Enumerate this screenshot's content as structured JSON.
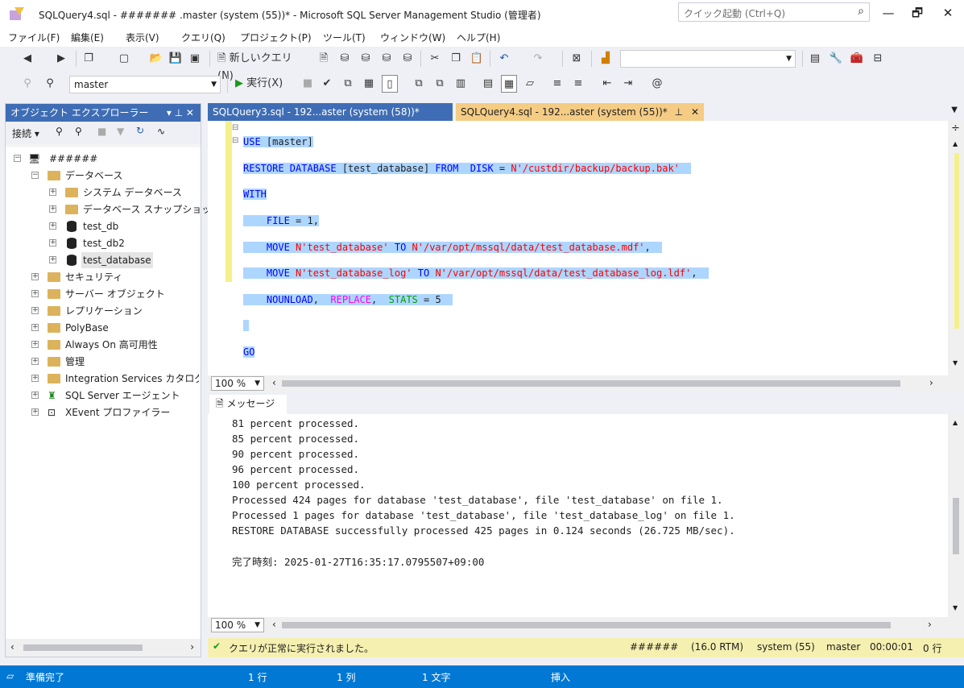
{
  "window": {
    "title": "SQLQuery4.sql - ####### .master (system (55))* - Microsoft SQL Server Management Studio (管理者)",
    "quick_launch_placeholder": "クイック起動 (Ctrl+Q)",
    "minimize": "—",
    "maximize": "🗗",
    "close": "✕"
  },
  "menu": [
    "ファイル(F)",
    "編集(E)",
    "表示(V)",
    "クエリ(Q)",
    "プロジェクト(P)",
    "ツール(T)",
    "ウィンドウ(W)",
    "ヘルプ(H)"
  ],
  "toolbar": {
    "new_query": "新しいクエリ(N)",
    "database": "master",
    "execute": "実行(X)"
  },
  "object_explorer": {
    "title": "オブジェクト エクスプローラー",
    "connect": "接続",
    "server": "######",
    "nodes": [
      {
        "label": "データベース",
        "expand": "−"
      },
      {
        "label": "システム データベース",
        "expand": "+"
      },
      {
        "label": "データベース スナップショット",
        "expand": "+"
      },
      {
        "label": "test_db",
        "expand": "+"
      },
      {
        "label": "test_db2",
        "expand": "+"
      },
      {
        "label": "test_database",
        "expand": "+"
      },
      {
        "label": "セキュリティ",
        "expand": "+"
      },
      {
        "label": "サーバー オブジェクト",
        "expand": "+"
      },
      {
        "label": "レプリケーション",
        "expand": "+"
      },
      {
        "label": "PolyBase",
        "expand": "+"
      },
      {
        "label": "Always On 高可用性",
        "expand": "+"
      },
      {
        "label": "管理",
        "expand": "+"
      },
      {
        "label": "Integration Services カタログ",
        "expand": "+"
      },
      {
        "label": "SQL Server エージェント",
        "expand": "+"
      },
      {
        "label": "XEvent プロファイラー",
        "expand": "+"
      }
    ]
  },
  "tabs": [
    {
      "label": "SQLQuery3.sql - 192...aster (system (58))*"
    },
    {
      "label": "SQLQuery4.sql - 192...aster (system (55))*"
    }
  ],
  "editor": {
    "zoom": "100 %",
    "lines": {
      "l1a": "USE",
      "l1b": " [master]",
      "l2a": "RESTORE DATABASE",
      "l2b": " [test_database] ",
      "l2c": "FROM",
      "l2d": "  DISK",
      "l2e": " = ",
      "l2f": "N'/custdir/backup/backup.bak'",
      "l3": "WITH",
      "l4a": "    FILE",
      "l4b": " = 1,",
      "l5a": "    MOVE ",
      "l5b": "N'test_database'",
      "l5c": " TO ",
      "l5d": "N'/var/opt/mssql/data/test_database.mdf'",
      "l5e": ",",
      "l6a": "    MOVE ",
      "l6b": "N'test_database_log'",
      "l6c": " TO ",
      "l6d": "N'/var/opt/mssql/data/test_database_log.ldf'",
      "l6e": ",",
      "l7a": "    NOUNLOAD",
      "l7b": ",  ",
      "l7c": "REPLACE",
      "l7d": ",  ",
      "l7e": "STATS",
      "l7f": " = 5",
      "l9": "GO"
    }
  },
  "messages": {
    "tab": "メッセージ",
    "zoom": "100 %",
    "lines": [
      "81 percent processed.",
      "85 percent processed.",
      "90 percent processed.",
      "96 percent processed.",
      "100 percent processed.",
      "Processed 424 pages for database 'test_database', file 'test_database' on file 1.",
      "Processed 1 pages for database 'test_database', file 'test_database_log' on file 1.",
      "RESTORE DATABASE successfully processed 425 pages in 0.124 seconds (26.725 MB/sec).",
      "",
      "完了時刻: 2025-01-27T16:35:17.0795507+09:00"
    ]
  },
  "query_status": {
    "text": "クエリが正常に実行されました。",
    "server": "######",
    "version": "(16.0 RTM)",
    "user": "system (55)",
    "db": "master",
    "time": "00:00:01",
    "rows": "0 行"
  },
  "statusbar": {
    "ready": "準備完了",
    "line": "1 行",
    "col": "1 列",
    "ch": "1 文字",
    "mode": "挿入"
  },
  "colors": {
    "accent": "#0078d4",
    "active_tab": "#f5cc84",
    "selection": "#add6ff"
  }
}
